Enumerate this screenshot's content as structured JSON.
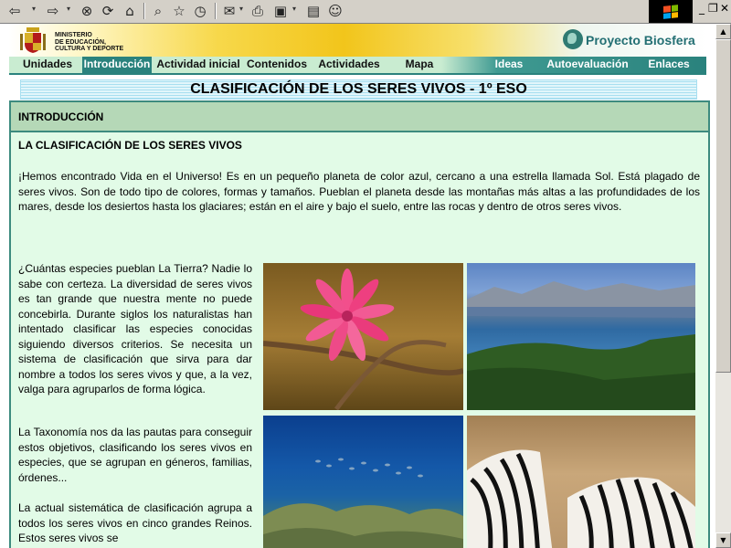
{
  "toolbar": {
    "back_icon": "back-arrow-icon",
    "forward_icon": "forward-arrow-icon",
    "caret": "▾"
  },
  "window_controls": {
    "minimize": "_",
    "restore": "❐",
    "close": "✕"
  },
  "header": {
    "ministry": "MINISTERIO\nDE EDUCACIÓN,\nCULTURA Y DEPORTE",
    "project": "Proyecto Biosfera"
  },
  "nav": {
    "items": [
      "Unidades",
      "Introducción",
      "Actividad inicial",
      "Contenidos",
      "Actividades",
      "Mapa",
      "Ideas",
      "Autoevaluación",
      "Enlaces"
    ],
    "active": "Introducción"
  },
  "title": "CLASIFICACIÓN DE LOS SERES VIVOS - 1º ESO",
  "section": {
    "heading": "INTRODUCCIÓN",
    "subheading": "LA CLASIFICACIÓN DE LOS SERES VIVOS",
    "intro": "¡Hemos encontrado Vida en el Universo! Es en un pequeño planeta de color azul, cercano a una estrella llamada Sol. Está plagado de seres vivos. Son de todo tipo de colores, formas y tamaños. Pueblan el planeta desde las montañas más altas a las profundidades de los mares, desde los desiertos hasta los glaciares; están en el aire y bajo el suelo, entre las rocas y dentro de otros seres vivos.",
    "paragraphs": [
      "¿Cuántas especies pueblan La Tierra? Nadie lo sabe con certeza. La diversidad de seres vivos es tan grande que nuestra mente no puede concebirla. Durante siglos los naturalistas han intentado clasificar las especies conocidas siguiendo diversos criterios. Se necesita un sistema de clasificación que sirva para dar nombre a todos los seres vivos y que, a la vez, valga para agruparlos de forma lógica.",
      "La Taxonomía nos da las pautas para conseguir estos objetivos, clasificando los seres vivos en especies, que se agrupan en géneros, familias, órdenes...",
      "La actual sistemática de clasificación agrupa a todos los seres vivos en cinco grandes Reinos. Estos seres vivos se"
    ]
  },
  "scrollbar": {
    "up": "▲",
    "down": "▼"
  }
}
